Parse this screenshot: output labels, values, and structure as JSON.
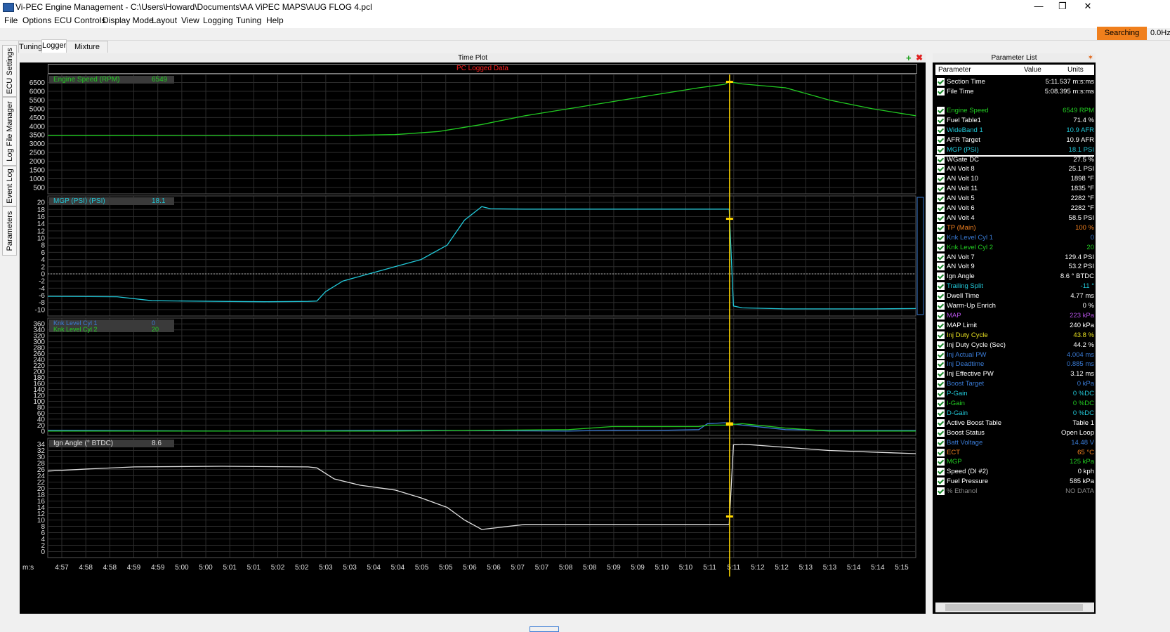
{
  "window": {
    "title": "Vi-PEC Engine Management - C:\\Users\\Howard\\Documents\\AA ViPEC MAPS\\AUG FLOG 4.pcl"
  },
  "menu": [
    "File",
    "Options",
    "ECU Controls",
    "Display Mode",
    "Layout",
    "View",
    "Logging",
    "Tuning",
    "Help"
  ],
  "status": {
    "searching": "Searching",
    "hz": "0.0Hz"
  },
  "tabs": [
    "Tuning",
    "Logger",
    "Mixture Map"
  ],
  "side_tabs": [
    "ECU Settings",
    "Log File Manager",
    "Event Log",
    "Parameters"
  ],
  "plot": {
    "title": "Time Plot",
    "banner": "PC Logged Data",
    "time_unit": "m:s",
    "time_labels": [
      "4:57",
      "4:58",
      "4:58",
      "4:59",
      "4:59",
      "5:00",
      "5:00",
      "5:01",
      "5:01",
      "5:02",
      "5:02",
      "5:03",
      "5:03",
      "5:04",
      "5:04",
      "5:05",
      "5:05",
      "5:06",
      "5:06",
      "5:07",
      "5:07",
      "5:08",
      "5:08",
      "5:09",
      "5:09",
      "5:10",
      "5:10",
      "5:11",
      "5:11",
      "5:12",
      "5:12",
      "5:13",
      "5:13",
      "5:14",
      "5:14",
      "5:15"
    ],
    "accent": "#ffd700"
  },
  "chart_data": [
    {
      "type": "line",
      "name": "Engine Speed (RPM)",
      "readout": "6549",
      "color": "#22cc22",
      "yticks": [
        "6500",
        "6000",
        "5500",
        "5000",
        "4500",
        "4000",
        "3500",
        "3000",
        "2500",
        "2000",
        "1500",
        "1000",
        "500"
      ],
      "ylim": [
        300,
        6800
      ],
      "x": [
        0,
        0.1,
        0.2,
        0.3,
        0.35,
        0.4,
        0.45,
        0.5,
        0.55,
        0.6,
        0.65,
        0.7,
        0.75,
        0.78,
        0.785,
        0.79,
        0.8,
        0.85,
        0.9,
        0.95,
        1.0
      ],
      "series": [
        {
          "name": "Engine Speed (RPM)",
          "values": [
            3480,
            3480,
            3470,
            3470,
            3480,
            3520,
            3700,
            4100,
            4600,
            5000,
            5400,
            5800,
            6200,
            6400,
            6540,
            6500,
            6420,
            6200,
            5500,
            5000,
            4600
          ]
        }
      ]
    },
    {
      "type": "line",
      "name": "MGP (PSI) (PSI)",
      "readout": "18.1",
      "color": "#22c8d8",
      "yticks": [
        "20",
        "18",
        "16",
        "14",
        "12",
        "10",
        "8",
        "6",
        "4",
        "2",
        "0",
        "-2",
        "-4",
        "-6",
        "-8",
        "-10"
      ],
      "ylim": [
        -11,
        21
      ],
      "x": [
        0,
        0.08,
        0.12,
        0.2,
        0.25,
        0.3,
        0.31,
        0.32,
        0.34,
        0.37,
        0.4,
        0.43,
        0.46,
        0.48,
        0.5,
        0.51,
        0.55,
        0.6,
        0.7,
        0.78,
        0.785,
        0.79,
        0.8,
        0.85,
        0.9,
        0.95,
        1.0
      ],
      "series": [
        {
          "name": "MGP (PSI)",
          "values": [
            -6.3,
            -6.4,
            -7.5,
            -7.7,
            -7.8,
            -7.7,
            -7.6,
            -5,
            -2,
            0,
            2,
            4,
            8,
            15,
            18.8,
            18.2,
            18.1,
            18.1,
            18.1,
            18.1,
            18.1,
            -9.0,
            -9.5,
            -9.8,
            -9.8,
            -9.8,
            -9.7
          ]
        }
      ]
    },
    {
      "type": "line",
      "name": "Knock Levels",
      "color": "#22cc22",
      "yticks": [
        "360",
        "340",
        "320",
        "300",
        "280",
        "260",
        "240",
        "220",
        "200",
        "180",
        "160",
        "140",
        "120",
        "100",
        "80",
        "60",
        "40",
        "20",
        "0"
      ],
      "ylim": [
        -5,
        370
      ],
      "x": [
        0,
        0.2,
        0.4,
        0.6,
        0.65,
        0.7,
        0.75,
        0.76,
        0.78,
        0.8,
        0.85,
        0.9,
        1.0
      ],
      "series": [
        {
          "name": "Knk Level Cyl 1",
          "readout": "0",
          "color": "#3a7bd5",
          "values": [
            3,
            0,
            3,
            0,
            3,
            2,
            5,
            25,
            28,
            20,
            5,
            2,
            2
          ]
        },
        {
          "name": "Knk Level Cyl 2",
          "readout": "20",
          "color": "#22cc22",
          "values": [
            0,
            0,
            0,
            5,
            15,
            15,
            15,
            20,
            20,
            25,
            10,
            0,
            0
          ]
        }
      ]
    },
    {
      "type": "line",
      "name": "Ign Angle (° BTDC)",
      "readout": "8.6",
      "color": "#e0e0e0",
      "yticks": [
        "34",
        "32",
        "30",
        "28",
        "26",
        "24",
        "22",
        "20",
        "18",
        "16",
        "14",
        "12",
        "10",
        "8",
        "6",
        "4",
        "2",
        "0"
      ],
      "ylim": [
        -1,
        35
      ],
      "x": [
        0,
        0.05,
        0.1,
        0.2,
        0.3,
        0.31,
        0.33,
        0.36,
        0.4,
        0.43,
        0.46,
        0.48,
        0.5,
        0.55,
        0.6,
        0.7,
        0.78,
        0.785,
        0.79,
        0.8,
        0.85,
        0.9,
        0.95,
        1.0
      ],
      "series": [
        {
          "name": "Ign Angle",
          "values": [
            25.5,
            26.2,
            26.8,
            27,
            26.8,
            26.5,
            23,
            21,
            19.5,
            17,
            14,
            10,
            7,
            8.6,
            8.6,
            8.6,
            8.6,
            8.6,
            33.8,
            34,
            33,
            32,
            31.5,
            31
          ]
        }
      ]
    }
  ],
  "parameters": {
    "title": "Parameter List",
    "headers": [
      "Parameter",
      "Value",
      "Units"
    ],
    "top": [
      {
        "name": "Section Time",
        "value": "5:11.537 m:s:ms",
        "color": "#ffffff"
      },
      {
        "name": "File Time",
        "value": "5:08.395 m:s:ms",
        "color": "#ffffff"
      }
    ],
    "rows": [
      {
        "name": "Engine Speed",
        "value": "6549 RPM",
        "color": "#22cc22"
      },
      {
        "name": "Fuel Table1",
        "value": "71.4 %",
        "color": "#ffffff"
      },
      {
        "name": "WideBand 1",
        "value": "10.9 AFR",
        "color": "#22c8d8"
      },
      {
        "name": "AFR Target",
        "value": "10.9 AFR",
        "color": "#ffffff"
      },
      {
        "name": "MGP (PSI)",
        "value": "18.1 PSI",
        "color": "#22c8d8"
      },
      {
        "name": "WGate DC",
        "value": "27.5 %",
        "color": "#ffffff"
      },
      {
        "name": "AN Volt 8",
        "value": "25.1 PSI",
        "color": "#ffffff"
      },
      {
        "name": "AN Volt 10",
        "value": "1898 °F",
        "color": "#ffffff"
      },
      {
        "name": "AN Volt 11",
        "value": "1835 °F",
        "color": "#ffffff"
      },
      {
        "name": "AN Volt 5",
        "value": "2282 °F",
        "color": "#ffffff"
      },
      {
        "name": "AN Volt 6",
        "value": "2282 °F",
        "color": "#ffffff"
      },
      {
        "name": "AN Volt 4",
        "value": "58.5 PSI",
        "color": "#ffffff"
      },
      {
        "name": "TP (Main)",
        "value": "100 %",
        "color": "#f08020"
      },
      {
        "name": "Knk Level Cyl 1",
        "value": "0",
        "color": "#3a7bd5"
      },
      {
        "name": "Knk Level Cyl 2",
        "value": "20",
        "color": "#22cc22"
      },
      {
        "name": "AN Volt 7",
        "value": "129.4 PSI",
        "color": "#ffffff"
      },
      {
        "name": "AN Volt 9",
        "value": "53.2 PSI",
        "color": "#ffffff"
      },
      {
        "name": "Ign Angle",
        "value": "8.6 ° BTDC",
        "color": "#ffffff"
      },
      {
        "name": "Trailing Split",
        "value": "-11 °",
        "color": "#22c8d8"
      },
      {
        "name": "Dwell Time",
        "value": "4.77 ms",
        "color": "#ffffff"
      },
      {
        "name": "Warm-Up Enrich",
        "value": "0 %",
        "color": "#ffffff"
      },
      {
        "name": "MAP",
        "value": "223 kPa",
        "color": "#b050e0"
      },
      {
        "name": "MAP Limit",
        "value": "240 kPa",
        "color": "#ffffff"
      },
      {
        "name": "Inj Duty Cycle",
        "value": "43.8 %",
        "color": "#e8e020"
      },
      {
        "name": "Inj Duty Cycle (Sec)",
        "value": "44.2 %",
        "color": "#ffffff"
      },
      {
        "name": "Inj Actual PW",
        "value": "4.004 ms",
        "color": "#3a7bd5"
      },
      {
        "name": "Inj Deadtime",
        "value": "0.885 ms",
        "color": "#3a7bd5"
      },
      {
        "name": "Inj Effective PW",
        "value": "3.12 ms",
        "color": "#ffffff"
      },
      {
        "name": "Boost Target",
        "value": "0 kPa",
        "color": "#3a7bd5"
      },
      {
        "name": "P-Gain",
        "value": "0 %DC",
        "color": "#22c8d8"
      },
      {
        "name": "I-Gain",
        "value": "0 %DC",
        "color": "#22cc22"
      },
      {
        "name": "D-Gain",
        "value": "0 %DC",
        "color": "#22c8d8"
      },
      {
        "name": "Active Boost Table",
        "value": "Table 1",
        "color": "#ffffff"
      },
      {
        "name": "Boost Status",
        "value": "Open Loop",
        "color": "#ffffff"
      },
      {
        "name": "Batt Voltage",
        "value": "14.48 V",
        "color": "#3a7bd5"
      },
      {
        "name": "ECT",
        "value": "65 °C",
        "color": "#f08020"
      },
      {
        "name": "MGP",
        "value": "125 kPa",
        "color": "#22cc22"
      },
      {
        "name": "Speed (DI #2)",
        "value": "0 kph",
        "color": "#ffffff"
      },
      {
        "name": "Fuel Pressure",
        "value": "585 kPa",
        "color": "#ffffff"
      },
      {
        "name": "% Ethanol",
        "value": "NO DATA",
        "color": "#888888"
      }
    ]
  }
}
